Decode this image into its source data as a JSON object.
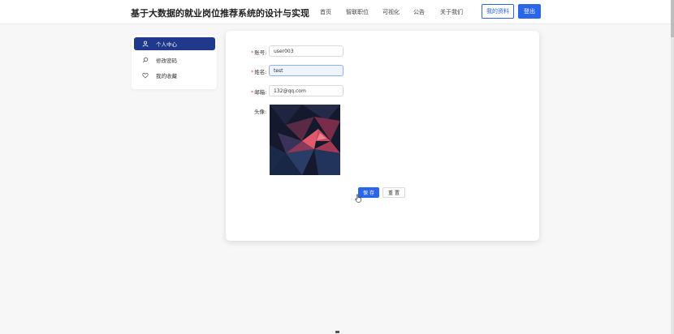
{
  "header": {
    "title": "基于大数据的就业岗位推荐系统的设计与实现",
    "nav": [
      "首页",
      "智联职位",
      "可视化",
      "公告",
      "关于我们"
    ],
    "profile_button": "我的资料",
    "logout_button": "登出",
    "accent_color": "#2c66e8"
  },
  "sidebar": {
    "items": [
      {
        "label": "个人中心",
        "icon": "user-icon",
        "active": true
      },
      {
        "label": "修改密码",
        "icon": "search-icon",
        "active": false
      },
      {
        "label": "我的收藏",
        "icon": "heart-icon",
        "active": false
      }
    ],
    "active_color": "#1f3a8c"
  },
  "form": {
    "account_label": "账号:",
    "account_value": "user003",
    "name_label": "姓名:",
    "name_value": "test",
    "email_label": "邮箱:",
    "email_value": "132@qq.com",
    "avatar_label": "头像:",
    "save_button": "保 存",
    "reset_button": "重 置"
  }
}
